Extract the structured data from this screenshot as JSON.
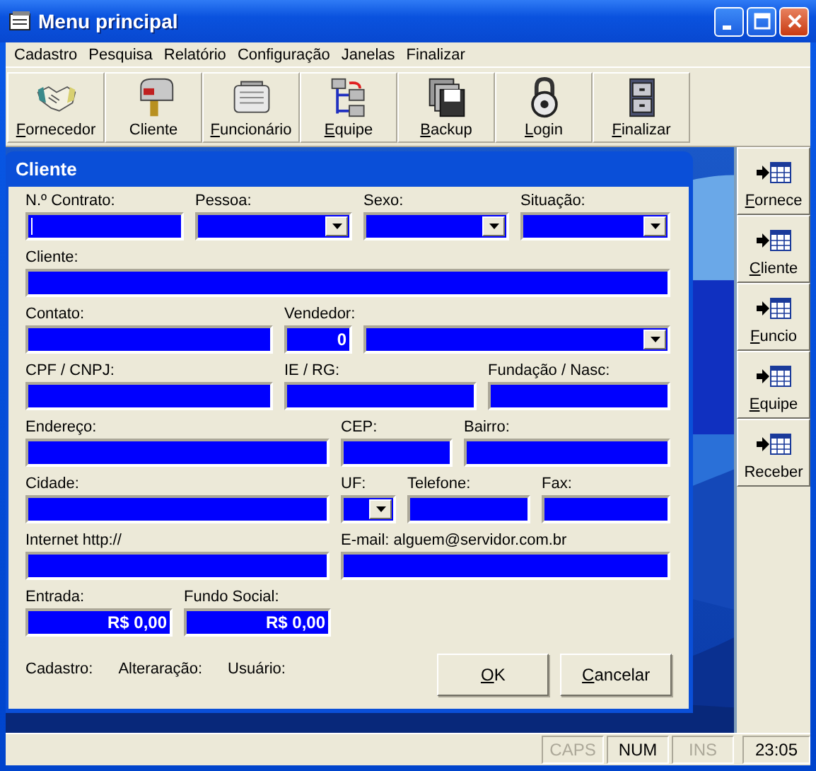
{
  "window": {
    "title": "Menu principal"
  },
  "menu": [
    "Cadastro",
    "Pesquisa",
    "Relatório",
    "Configuração",
    "Janelas",
    "Finalizar"
  ],
  "toolbar": [
    {
      "label": "Fornecedor",
      "mnemonic": true,
      "kind": "handshake"
    },
    {
      "label": "Cliente",
      "mnemonic": false,
      "kind": "mailbox"
    },
    {
      "label": "Funcionário",
      "mnemonic": true,
      "kind": "binder"
    },
    {
      "label": "Equipe",
      "mnemonic": true,
      "kind": "tree"
    },
    {
      "label": "Backup",
      "mnemonic": true,
      "kind": "disks"
    },
    {
      "label": "Login",
      "mnemonic": true,
      "kind": "lock"
    },
    {
      "label": "Finalizar",
      "mnemonic": true,
      "kind": "cabinet"
    }
  ],
  "side_panel": [
    {
      "label": "Fornece",
      "mnemonic": true
    },
    {
      "label": "Cliente",
      "mnemonic": true
    },
    {
      "label": "Funcio",
      "mnemonic": true
    },
    {
      "label": "Equipe",
      "mnemonic": true
    },
    {
      "label": "Receber",
      "mnemonic": false
    }
  ],
  "dialog": {
    "title": "Cliente",
    "rows": [
      [
        {
          "kind": "text",
          "label": "N.º Contrato:",
          "focused": true
        },
        {
          "kind": "combo",
          "label": "Pessoa:",
          "focused": false
        },
        {
          "kind": "combo",
          "label": "Sexo:",
          "focused": false
        },
        {
          "kind": "combo",
          "label": "Situação:",
          "focused": false
        }
      ],
      [
        {
          "kind": "text",
          "label": "Cliente:",
          "focused": false
        }
      ],
      [
        {
          "kind": "text",
          "label": "Contato:",
          "focused": false
        },
        {
          "kind": "number",
          "label": "Vendedor:",
          "value": "0",
          "focused": false
        },
        {
          "kind": "combo",
          "focused": false
        }
      ],
      [
        {
          "kind": "text",
          "label": "CPF / CNPJ:",
          "focused": false
        },
        {
          "kind": "text",
          "label": "IE / RG:",
          "focused": false
        },
        {
          "kind": "text",
          "label": "Fundação / Nasc:",
          "focused": false
        }
      ],
      [
        {
          "kind": "text",
          "label": "Endereço:",
          "focused": false
        },
        {
          "kind": "text",
          "label": "CEP:",
          "focused": false
        },
        {
          "kind": "text",
          "label": "Bairro:",
          "focused": false
        }
      ],
      [
        {
          "kind": "text",
          "label": "Cidade:",
          "focused": false
        },
        {
          "kind": "combo",
          "label": "UF:",
          "focused": false
        },
        {
          "kind": "text",
          "label": "Telefone:",
          "focused": false
        },
        {
          "kind": "text",
          "label": "Fax:",
          "focused": false
        }
      ],
      [
        {
          "kind": "text",
          "label": "Internet http://",
          "focused": false
        },
        {
          "kind": "text",
          "label": "E-mail: alguem@servidor.com.br",
          "focused": false
        }
      ],
      [
        {
          "kind": "number",
          "label": "Entrada:",
          "value": "R$ 0,00",
          "focused": false
        },
        {
          "kind": "number",
          "label": "Fundo Social:",
          "value": "R$ 0,00",
          "focused": false
        }
      ]
    ],
    "info": [
      "Cadastro:",
      "Alteraração:",
      "Usuário:"
    ],
    "buttons": [
      {
        "label": "OK",
        "mnemonic": true
      },
      {
        "label": "Cancelar",
        "mnemonic": true
      }
    ]
  },
  "status_bar": {
    "panels": [
      {
        "text": "CAPS",
        "on": false
      },
      {
        "text": "NUM",
        "on": true
      },
      {
        "text": "INS",
        "on": false
      }
    ],
    "time": "23:05"
  }
}
